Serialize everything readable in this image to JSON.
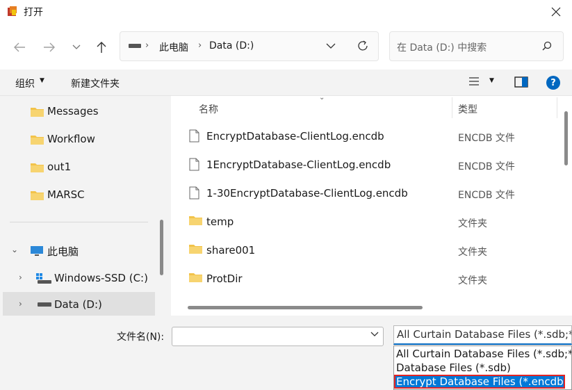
{
  "window": {
    "title": "打开"
  },
  "address": {
    "segments": [
      "此电脑",
      "Data (D:)"
    ]
  },
  "search": {
    "placeholder": "在 Data (D:) 中搜索"
  },
  "toolbar": {
    "organize": "组织",
    "new_folder": "新建文件夹"
  },
  "nav": {
    "items": [
      {
        "label": "Messages"
      },
      {
        "label": "Workflow"
      },
      {
        "label": "out1"
      },
      {
        "label": "MARSC"
      }
    ],
    "this_pc": "此电脑",
    "drives": [
      {
        "label": "Windows-SSD (C:)"
      },
      {
        "label": "Data (D:)"
      }
    ]
  },
  "files": {
    "columns": {
      "name": "名称",
      "type": "类型"
    },
    "rows": [
      {
        "name": "EncryptDatabase-ClientLog.encdb",
        "type": "ENCDB 文件",
        "kind": "file"
      },
      {
        "name": "1EncryptDatabase-ClientLog.encdb",
        "type": "ENCDB 文件",
        "kind": "file"
      },
      {
        "name": "1-30EncryptDatabase-ClientLog.encdb",
        "type": "ENCDB 文件",
        "kind": "file"
      },
      {
        "name": "temp",
        "type": "文件夹",
        "kind": "folder"
      },
      {
        "name": "share001",
        "type": "文件夹",
        "kind": "folder"
      },
      {
        "name": "ProtDir",
        "type": "文件夹",
        "kind": "folder"
      }
    ]
  },
  "bottom": {
    "filename_label": "文件名(N):",
    "filename_value": "",
    "filter_selected": "All Curtain Database Files (*.sdb;*.encdb)",
    "filter_options": [
      "All Curtain Database Files (*.sdb;*.encdb)",
      "Database Files (*.sdb)",
      "Encrypt Database Files (*.encdb)"
    ]
  },
  "colors": {
    "accent": "#0067c0",
    "highlight": "#0078d7",
    "annotation": "#e32424",
    "folder": "#f2c34a"
  }
}
